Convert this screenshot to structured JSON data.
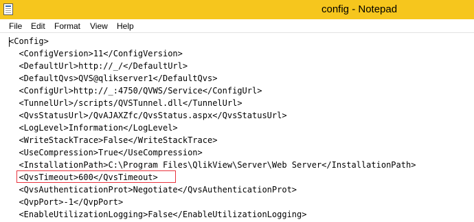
{
  "window": {
    "title": "config - Notepad",
    "title_bar_color": "#f6c61d",
    "app_icon": "notepad-icon"
  },
  "menu": {
    "items": [
      "File",
      "Edit",
      "Format",
      "View",
      "Help"
    ]
  },
  "editor": {
    "lines": [
      "<Config>",
      "  <ConfigVersion>11</ConfigVersion>",
      "  <DefaultUrl>http://_/</DefaultUrl>",
      "  <DefaultQvs>QVS@qlikserver1</DefaultQvs>",
      "  <ConfigUrl>http://_:4750/QVWS/Service</ConfigUrl>",
      "  <TunnelUrl>/scripts/QVSTunnel.dll</TunnelUrl>",
      "  <QvsStatusUrl>/QvAJAXZfc/QvsStatus.aspx</QvsStatusUrl>",
      "  <LogLevel>Information</LogLevel>",
      "  <WriteStackTrace>False</WriteStackTrace>",
      "  <UseCompression>True</UseCompression>",
      "  <InstallationPath>C:\\Program Files\\QlikView\\Server\\Web Server</InstallationPath>",
      "  <QvsTimeout>600</QvsTimeout>",
      "  <QvsAuthenticationProt>Negotiate</QvsAuthenticationProt>",
      "  <QvpPort>-1</QvpPort>",
      "  <EnableUtilizationLogging>False</EnableUtilizationLogging>"
    ],
    "highlighted_line_index": 11,
    "highlight_color": "#e8323c"
  }
}
